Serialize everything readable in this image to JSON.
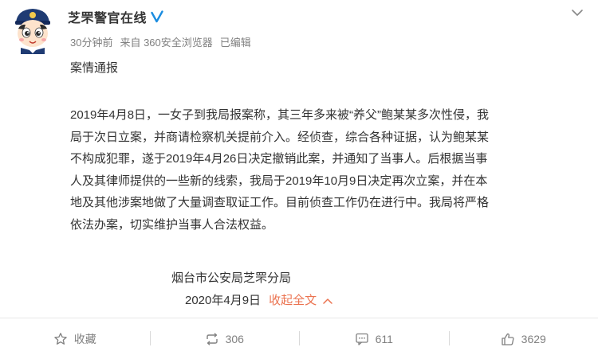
{
  "colors": {
    "accent": "#eb7350",
    "text": "#333333",
    "meta": "#808080",
    "verified": "#1a8ce0",
    "divider": "#e8e8e8"
  },
  "header": {
    "username": "芝罘警官在线",
    "meta": {
      "time": "30分钟前",
      "source": "来自 360安全浏览器",
      "edited": "已编辑"
    }
  },
  "post": {
    "title": "案情通报",
    "body_lines": [
      "2019年4月8日，一女子到我局报案称，其三年多来被“养父”鲍某某多次性侵，我",
      "局于次日立案，并商请检察机关提前介入。经侦查，综合各种证据，认为鲍某某",
      "不构成犯罪，遂于2019年4月26日决定撤销此案，并通知了当事人。后根据当事",
      "人及其律师提供的一些新的线索，我局于2019年10月9日决定再次立案，并在本",
      "地及其他涉案地做了大量调查取证工作。目前侦查工作仍在进行中。我局将严格",
      "依法办案，切实维护当事人合法权益。"
    ],
    "signature": "烟台市公安局芝罘分局",
    "date": "2020年4月9日",
    "collapse_label": "收起全文"
  },
  "actions": {
    "favorite": {
      "label": "收藏",
      "icon": "star-icon"
    },
    "repost": {
      "label": "306",
      "icon": "repost-icon"
    },
    "comment": {
      "label": "611",
      "icon": "comment-icon"
    },
    "like": {
      "label": "3629",
      "icon": "thumbs-up-icon"
    }
  }
}
